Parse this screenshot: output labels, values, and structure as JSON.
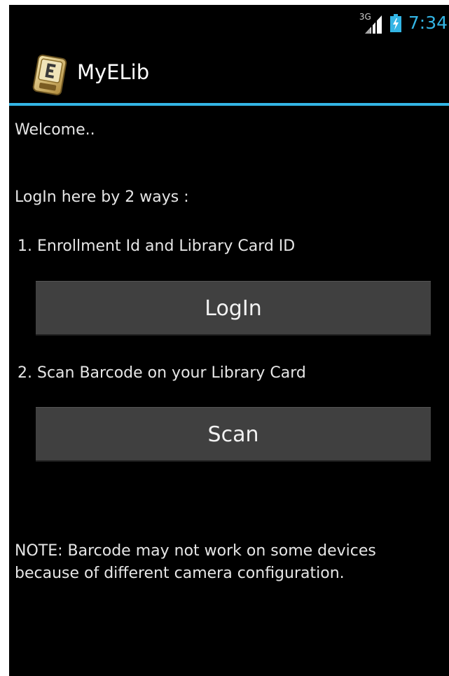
{
  "status_bar": {
    "network_type": "3G",
    "time": "7:34",
    "icons": [
      "signal-icon",
      "battery-charging-icon"
    ]
  },
  "action_bar": {
    "app_icon": "app-logo-icon",
    "title": "MyELib"
  },
  "content": {
    "welcome": "Welcome..",
    "login_intro": "LogIn here by 2 ways :",
    "option1": "1. Enrollment Id and Library Card ID",
    "login_button": "LogIn",
    "option2": "2. Scan Barcode on your Library Card",
    "scan_button": "Scan",
    "note": "NOTE: Barcode may not work on some devices because of different camera configuration."
  },
  "colors": {
    "background": "#000000",
    "accent": "#33b5e5",
    "button": "#404040",
    "text": "#e6e6e6"
  }
}
